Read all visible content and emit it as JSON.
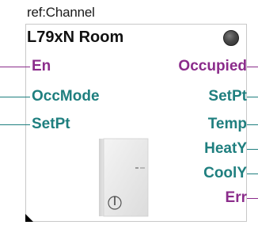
{
  "header": {
    "ref": "ref:Channel",
    "title": "L79xN Room"
  },
  "colors": {
    "input_en": "#7a2a7a",
    "input_teal": "#1f7a7a",
    "output_purple": "#7a2a7a",
    "output_teal": "#1f7a7a"
  },
  "inputs": [
    {
      "label": "En",
      "color": "#8b2c8b"
    },
    {
      "label": "OccMode",
      "color": "#1f7f7f"
    },
    {
      "label": "SetPt",
      "color": "#1f7f7f"
    }
  ],
  "outputs": [
    {
      "label": "Occupied",
      "color": "#8b2c8b"
    },
    {
      "label": "SetPt",
      "color": "#1f7f7f"
    },
    {
      "label": "Temp",
      "color": "#1f7f7f"
    },
    {
      "label": "HeatY",
      "color": "#1f7f7f"
    },
    {
      "label": "CoolY",
      "color": "#1f7f7f"
    },
    {
      "label": "Err",
      "color": "#8b2c8b"
    }
  ],
  "icons": {
    "status": "status-led-icon",
    "device": "room-thermostat-device-icon",
    "corner": "resize-corner-icon"
  }
}
